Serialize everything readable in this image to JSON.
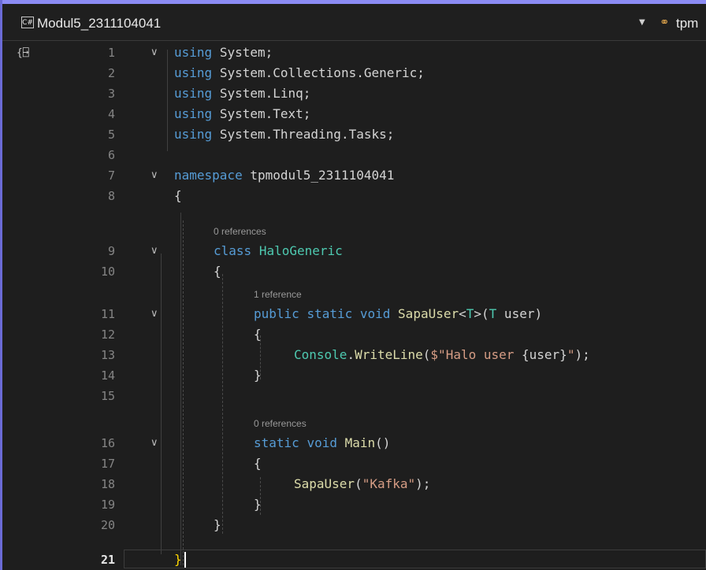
{
  "header": {
    "language_badge": "C#",
    "project": "Modul5_2311104041",
    "member_dropdown_text": "tpm"
  },
  "editor": {
    "lines": [
      {
        "n": "1",
        "code": "using System;"
      },
      {
        "n": "2",
        "code": "using System.Collections.Generic;"
      },
      {
        "n": "3",
        "code": "using System.Linq;"
      },
      {
        "n": "4",
        "code": "using System.Text;"
      },
      {
        "n": "5",
        "code": "using System.Threading.Tasks;"
      },
      {
        "n": "6",
        "code": ""
      },
      {
        "n": "7",
        "code": "namespace tpmodul5_2311104041"
      },
      {
        "n": "8",
        "code": "{"
      },
      {
        "n": "9",
        "code": "class HaloGeneric"
      },
      {
        "n": "10",
        "code": "{"
      },
      {
        "n": "11",
        "code": "public static void SapaUser<T>(T user)"
      },
      {
        "n": "12",
        "code": "{"
      },
      {
        "n": "13",
        "code": "Console.WriteLine($\"Halo user {user}\");"
      },
      {
        "n": "14",
        "code": "}"
      },
      {
        "n": "15",
        "code": ""
      },
      {
        "n": "16",
        "code": "static void Main()"
      },
      {
        "n": "17",
        "code": "{"
      },
      {
        "n": "18",
        "code": "SapaUser(\"Kafka\");"
      },
      {
        "n": "19",
        "code": "}"
      },
      {
        "n": "20",
        "code": "}"
      },
      {
        "n": "21",
        "code": "}"
      }
    ],
    "codelens": {
      "class_refs": "0 references",
      "sapauser_refs": "1 reference",
      "main_refs": "0 references"
    },
    "tokens": {
      "using": "using",
      "System": "System",
      "semi": ";",
      "gen": "System.Collections.Generic",
      "linq": "System.Linq",
      "text": "System.Text",
      "tasks": "System.Threading.Tasks",
      "namespace": "namespace",
      "ns_name": "tpmodul5_2311104041",
      "open": "{",
      "close": "}",
      "class": "class",
      "class_name": "HaloGeneric",
      "public": "public",
      "static": "static",
      "void": "void",
      "sapauser": "SapaUser",
      "lt": "<",
      "T": "T",
      "gt_paren": ">(",
      "user_param": " user)",
      "console": "Console",
      "dot": ".",
      "writeline": "WriteLine",
      "paren_open": "(",
      "interp_start": "$\"Halo user ",
      "interp_expr": "{user}",
      "interp_end": "\"",
      "paren_close_semi": ");",
      "main": "Main",
      "parens": "()",
      "kafka": "\"Kafka\""
    }
  }
}
